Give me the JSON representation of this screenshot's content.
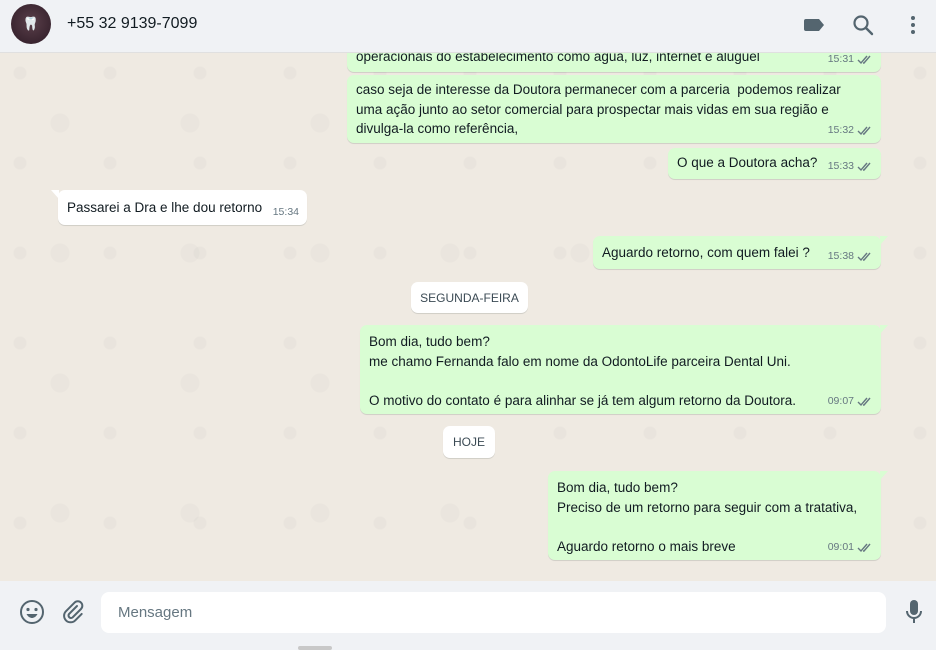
{
  "header": {
    "contact_name": "+55 32 9139-7099",
    "avatar_icon": "tooth-logo-icon",
    "icons": [
      "label-icon",
      "search-icon",
      "menu-icon"
    ]
  },
  "messages": [
    {
      "type": "out",
      "text": "operacionais do estabelecimento como água, luz, internet e aluguel",
      "time": "15:31",
      "status": "read"
    },
    {
      "type": "out",
      "text": "caso seja de interesse da Doutora permanecer com a parceria  podemos realizar\numa ação junto ao setor comercial para prospectar mais vidas em sua região e\ndivulga-la como referência,",
      "time": "15:32",
      "status": "read"
    },
    {
      "type": "out",
      "text": "O que a Doutora acha?",
      "time": "15:33",
      "status": "read"
    },
    {
      "type": "in",
      "text": "Passarei a Dra e lhe dou retorno",
      "time": "15:34"
    },
    {
      "type": "out",
      "text": "Aguardo retorno, com quem falei ?",
      "time": "15:38",
      "status": "read"
    },
    {
      "type": "out",
      "text": "Bom dia, tudo bem?\nme chamo Fernanda falo em nome da OdontoLife parceira Dental Uni.\n\nO motivo do contato é para alinhar se já tem algum retorno da Doutora.",
      "time": "09:07",
      "status": "read"
    },
    {
      "type": "out",
      "text": "Bom dia, tudo bem?\nPreciso de um retorno para seguir com a tratativa,\n\nAguardo retorno o mais breve",
      "time": "09:01",
      "status": "read"
    }
  ],
  "date_chips": [
    "SEGUNDA-FEIRA",
    "HOJE"
  ],
  "footer": {
    "placeholder": "Mensagem",
    "value": "",
    "icons": [
      "emoji-icon",
      "attach-icon",
      "mic-icon"
    ]
  },
  "colors": {
    "outgoing_bubble": "#d9fdd3",
    "incoming_bubble": "#ffffff",
    "chat_background": "#efeae2",
    "header_bg": "#f0f2f5",
    "read_tick": "#667781"
  }
}
